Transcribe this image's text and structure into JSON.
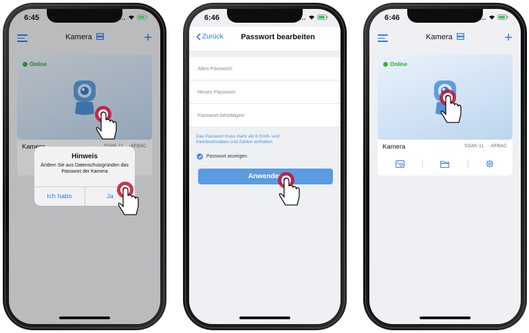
{
  "screens": [
    {
      "status_time": "6:45",
      "nav_title": "Kamera",
      "online_label": "Online",
      "device_name": "Kamera",
      "device_serial": "SSAK-11",
      "device_id": "-AFBAC",
      "dialog": {
        "title": "Hinweis",
        "message": "Ändern Sie aus Datenschutzgründen das Passwort der Kamera",
        "button_cancel": "Ich habs",
        "button_ok": "Ja"
      }
    },
    {
      "status_time": "6:46",
      "back_label": "Zurück",
      "nav_title": "Passwort bearbeiten",
      "fields": [
        {
          "placeholder": "Altes Passwort:"
        },
        {
          "placeholder": "Neues Passwort:"
        },
        {
          "placeholder": "Passwort bestätigen:"
        }
      ],
      "hint": "Das Passwort muss mehr als 8 Groß- und Kleinbuchstaben und Zahlen enthalten",
      "show_password_label": "Passwort anzeigen",
      "apply_button": "Anwenden"
    },
    {
      "status_time": "6:46",
      "nav_title": "Kamera",
      "online_label": "Online",
      "device_name": "Kamera",
      "device_serial": "SSAK-11",
      "device_id": "-AFBAC",
      "actions": [
        "playback-icon",
        "folder-icon",
        "gear-icon"
      ]
    }
  ],
  "colors": {
    "accent": "#2c7be5",
    "online": "#34b234",
    "tap_marker": "#c8102e",
    "button": "#5b9be0",
    "hint": "#4a90d9"
  }
}
